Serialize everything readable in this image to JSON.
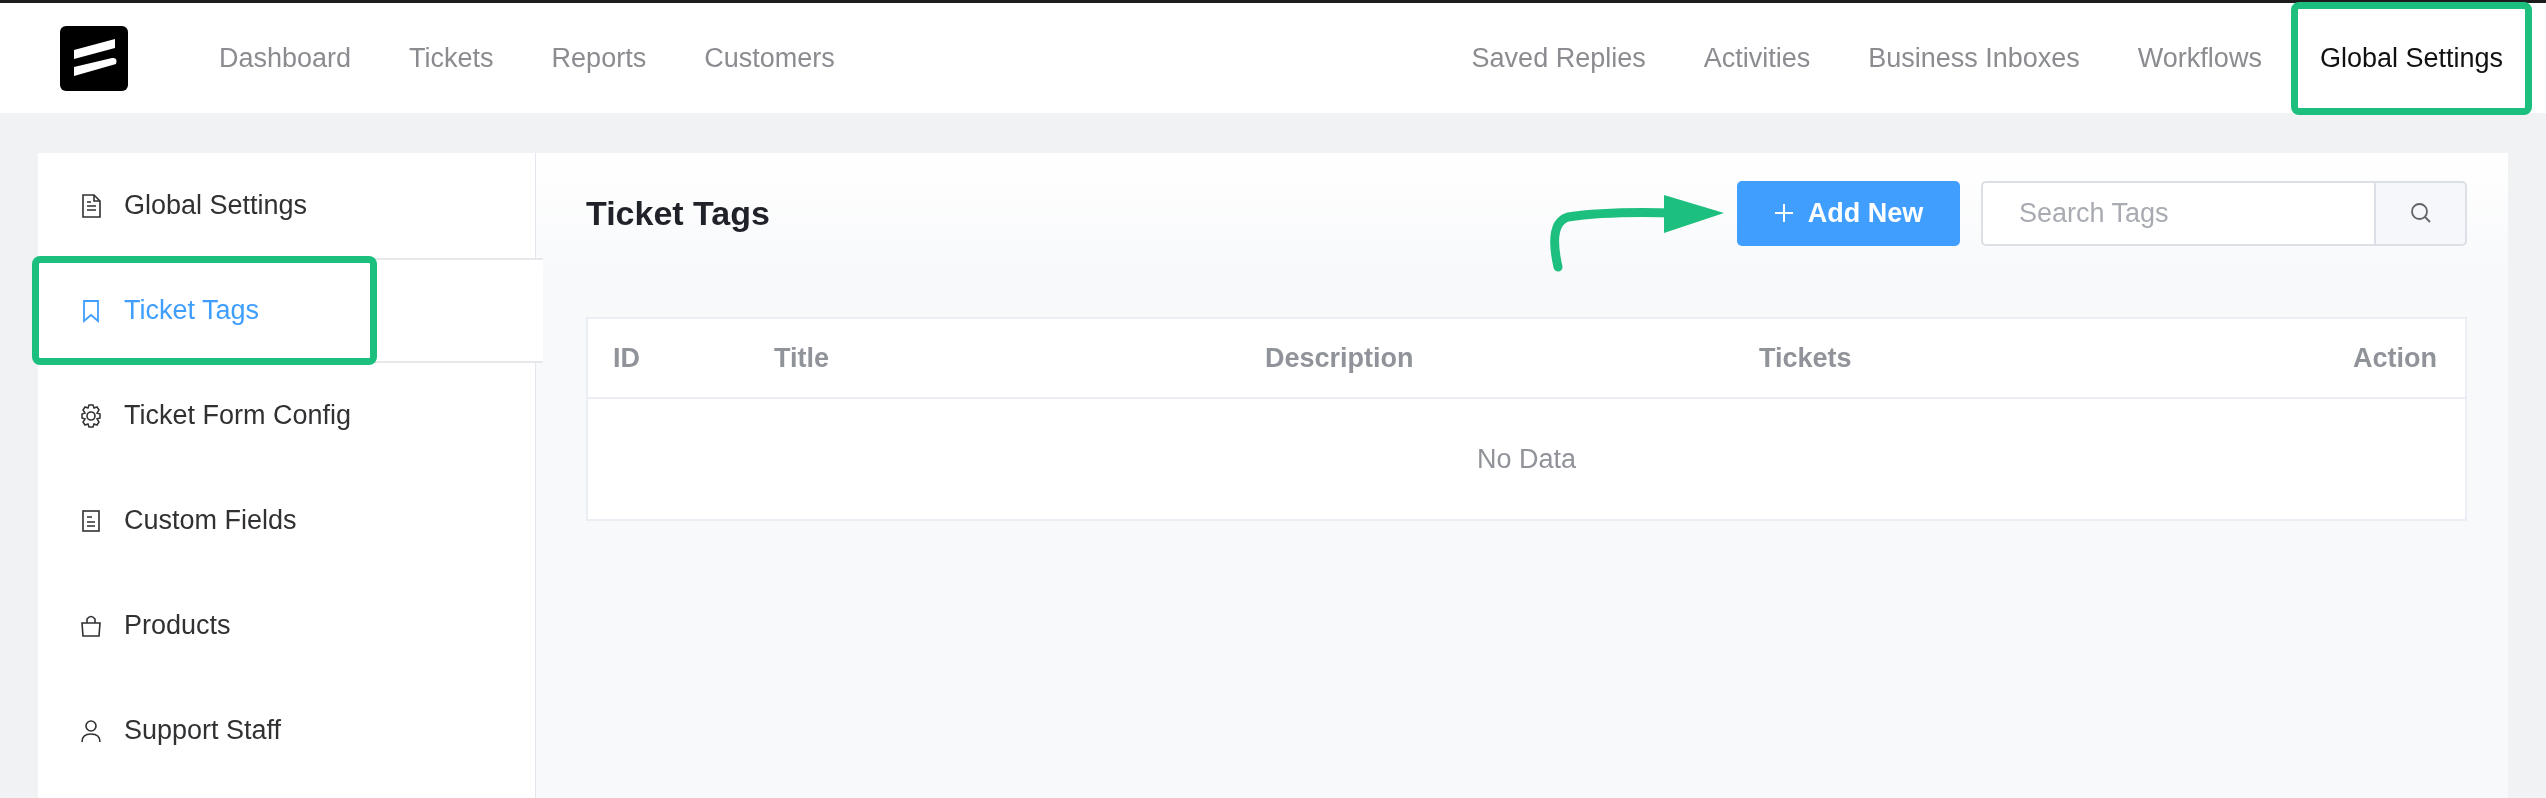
{
  "nav_left": [
    {
      "label": "Dashboard",
      "selected": false,
      "highlighted": false
    },
    {
      "label": "Tickets",
      "selected": false,
      "highlighted": false
    },
    {
      "label": "Reports",
      "selected": false,
      "highlighted": false
    },
    {
      "label": "Customers",
      "selected": false,
      "highlighted": false
    }
  ],
  "nav_right": [
    {
      "label": "Saved Replies",
      "selected": false,
      "highlighted": false
    },
    {
      "label": "Activities",
      "selected": false,
      "highlighted": false
    },
    {
      "label": "Business Inboxes",
      "selected": false,
      "highlighted": false
    },
    {
      "label": "Workflows",
      "selected": false,
      "highlighted": false
    },
    {
      "label": "Global Settings",
      "selected": true,
      "highlighted": true
    }
  ],
  "sidebar": {
    "items": [
      {
        "label": "Global Settings",
        "selected": false,
        "highlighted": false
      },
      {
        "label": "Ticket Tags",
        "selected": true,
        "highlighted": true
      },
      {
        "label": "Ticket Form Config",
        "selected": false,
        "highlighted": false
      },
      {
        "label": "Custom Fields",
        "selected": false,
        "highlighted": false
      },
      {
        "label": "Products",
        "selected": false,
        "highlighted": false
      },
      {
        "label": "Support Staff",
        "selected": false,
        "highlighted": false
      }
    ]
  },
  "page": {
    "title": "Ticket Tags",
    "add_button": "Add New",
    "search": {
      "placeholder": "Search Tags"
    },
    "table": {
      "columns": [
        "ID",
        "Title",
        "Description",
        "Tickets",
        "Action"
      ],
      "empty_text": "No Data"
    }
  }
}
